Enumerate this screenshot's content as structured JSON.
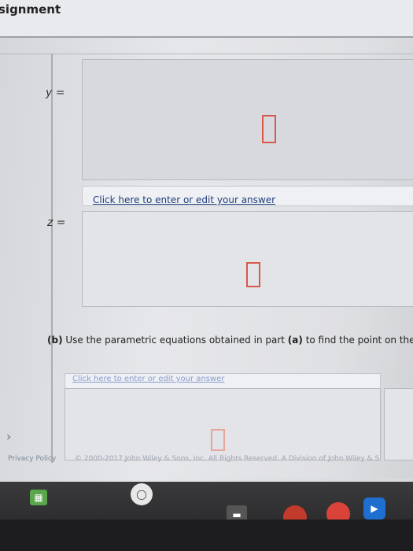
{
  "header": {
    "title": "signment"
  },
  "question": {
    "y_label": "y =",
    "z_label": "z =",
    "part_b_prefix": "(b)",
    "part_b_text_1": " Use the parametric equations obtained in part ",
    "part_b_ref": "(a)",
    "part_b_text_2": " to find the point on the lin"
  },
  "links": {
    "edit_answer_1": "Click here to enter or edit your answer",
    "edit_answer_2": "Click here to enter or edit your answer"
  },
  "footer": {
    "privacy": "Privacy Policy",
    "copyright": "© 2000-2017 John Wiley & Sons, Inc. All Rights Reserved. A Division of John Wiley & S"
  },
  "colors": {
    "answer_placeholder_border": "#d9574d",
    "link": "#1f3c7a",
    "accent_tab": "#e39a55"
  },
  "taskbar": {
    "icons": [
      "app-launcher-icon",
      "chrome-icon",
      "circle-app-icon",
      "store-icon",
      "chrome-app-icon",
      "play-icon"
    ]
  }
}
